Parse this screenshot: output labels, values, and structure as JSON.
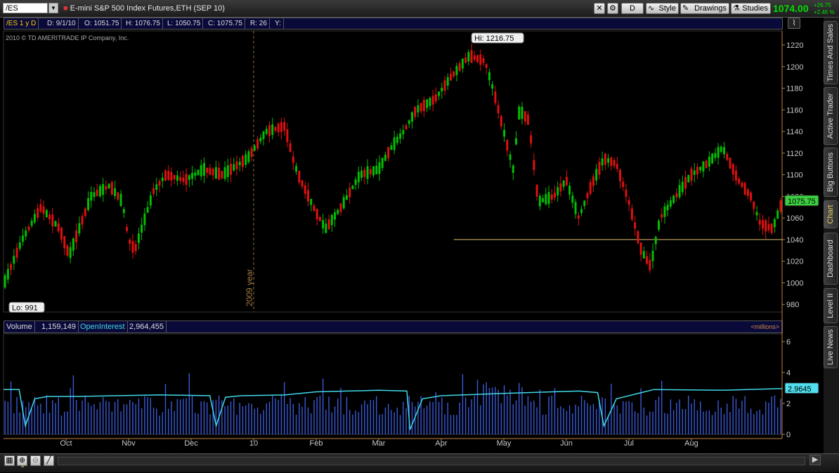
{
  "toolbar": {
    "symbol": "/ES",
    "description": "E-mini S&P 500 Index Futures,ETH (SEP 10)",
    "period_button": "D",
    "style_button": "Style",
    "drawings_button": "Drawings",
    "studies_button": "Studies",
    "last_price": "1074.00",
    "change": "+26.75",
    "change_pct": "+2.46 %"
  },
  "info_bar": {
    "title": "/ES 1 y D",
    "date": "D: 9/1/10",
    "open": "O: 1051.75",
    "high": "H: 1076.75",
    "low": "L: 1050.75",
    "close": "C: 1075.75",
    "range": "R: 26",
    "y": "Y:"
  },
  "copyright": "2010 © TD AMERITRADE IP Company, Inc.",
  "annotations": {
    "hi_label": "Hi: 1216.75",
    "lo_label": "Lo: 991",
    "year_label": "2009 year",
    "price_tag": "1075.75",
    "oi_tag": "2.9645"
  },
  "volume_bar": {
    "volume_label": "Volume",
    "volume_value": "1,159,149",
    "oi_label": "OpenInterest",
    "oi_value": "2,964,455",
    "units": "<millions>"
  },
  "side_tabs": [
    "Times And Sales",
    "Active Trader",
    "Big Buttons",
    "Chart",
    "Dashboard",
    "Level II",
    "Live News"
  ],
  "chart_data": {
    "type": "candlestick",
    "price_axis": {
      "ticks": [
        980,
        1000,
        1020,
        1040,
        1060,
        1080,
        1100,
        1120,
        1140,
        1160,
        1180,
        1200,
        1220
      ],
      "range": [
        973,
        1233
      ]
    },
    "volume_axis": {
      "ticks": [
        0,
        2,
        4,
        6
      ],
      "range": [
        0,
        6.5
      ],
      "unit": "millions"
    },
    "x_labels": [
      "Oct",
      "Nov",
      "Dec",
      "10",
      "Feb",
      "Mar",
      "Apr",
      "May",
      "Jun",
      "Jul",
      "Aug"
    ],
    "x_label_month_index": [
      1,
      2,
      3,
      4,
      5,
      6,
      7,
      8,
      9,
      10,
      11
    ],
    "support_line": 1040,
    "support_line_start_month": 7.2,
    "price_path": [
      [
        0,
        998
      ],
      [
        0.3,
        1040
      ],
      [
        0.6,
        1070
      ],
      [
        0.9,
        1050
      ],
      [
        1.05,
        1025
      ],
      [
        1.4,
        1080
      ],
      [
        1.7,
        1090
      ],
      [
        1.9,
        1075
      ],
      [
        2.0,
        1040
      ],
      [
        2.1,
        1030
      ],
      [
        2.4,
        1085
      ],
      [
        2.6,
        1100
      ],
      [
        2.9,
        1095
      ],
      [
        3.2,
        1105
      ],
      [
        3.5,
        1100
      ],
      [
        3.9,
        1115
      ],
      [
        4.2,
        1140
      ],
      [
        4.5,
        1145
      ],
      [
        4.65,
        1110
      ],
      [
        4.75,
        1095
      ],
      [
        5.0,
        1065
      ],
      [
        5.15,
        1050
      ],
      [
        5.4,
        1070
      ],
      [
        5.7,
        1100
      ],
      [
        6.0,
        1105
      ],
      [
        6.2,
        1125
      ],
      [
        6.4,
        1140
      ],
      [
        6.6,
        1160
      ],
      [
        6.9,
        1170
      ],
      [
        7.15,
        1190
      ],
      [
        7.45,
        1210
      ],
      [
        7.7,
        1205
      ],
      [
        7.85,
        1175
      ],
      [
        8.0,
        1140
      ],
      [
        8.15,
        1105
      ],
      [
        8.25,
        1160
      ],
      [
        8.4,
        1150
      ],
      [
        8.55,
        1075
      ],
      [
        8.8,
        1080
      ],
      [
        9.0,
        1095
      ],
      [
        9.2,
        1060
      ],
      [
        9.4,
        1090
      ],
      [
        9.6,
        1115
      ],
      [
        9.8,
        1110
      ],
      [
        10.0,
        1075
      ],
      [
        10.2,
        1030
      ],
      [
        10.35,
        1015
      ],
      [
        10.5,
        1060
      ],
      [
        10.75,
        1080
      ],
      [
        11.0,
        1100
      ],
      [
        11.25,
        1110
      ],
      [
        11.5,
        1125
      ],
      [
        11.75,
        1095
      ],
      [
        11.95,
        1080
      ],
      [
        12.1,
        1055
      ],
      [
        12.3,
        1050
      ],
      [
        12.45,
        1075
      ]
    ],
    "volume_baseline_millions": 2.2,
    "open_interest_path": [
      [
        0,
        2.9
      ],
      [
        0.25,
        2.9
      ],
      [
        0.35,
        0.55
      ],
      [
        0.5,
        2.3
      ],
      [
        0.7,
        2.45
      ],
      [
        1.2,
        2.45
      ],
      [
        2.5,
        2.55
      ],
      [
        3.3,
        2.5
      ],
      [
        3.4,
        0.55
      ],
      [
        3.55,
        2.4
      ],
      [
        3.8,
        2.5
      ],
      [
        4.5,
        2.55
      ],
      [
        5.0,
        2.75
      ],
      [
        6.0,
        2.85
      ],
      [
        6.45,
        2.8
      ],
      [
        6.5,
        0.3
      ],
      [
        6.7,
        2.3
      ],
      [
        7.0,
        2.5
      ],
      [
        8.0,
        2.65
      ],
      [
        9.2,
        2.8
      ],
      [
        9.5,
        2.7
      ],
      [
        9.6,
        0.55
      ],
      [
        9.8,
        2.3
      ],
      [
        10.2,
        2.7
      ],
      [
        10.4,
        2.9
      ],
      [
        11.5,
        2.85
      ],
      [
        12.45,
        2.96
      ]
    ]
  },
  "colors": {
    "up": "#00c000",
    "down": "#e01010",
    "volume": "#3a5ad8",
    "open_interest": "#40d8e8",
    "axis": "#c08040",
    "support": "#e8c070"
  }
}
